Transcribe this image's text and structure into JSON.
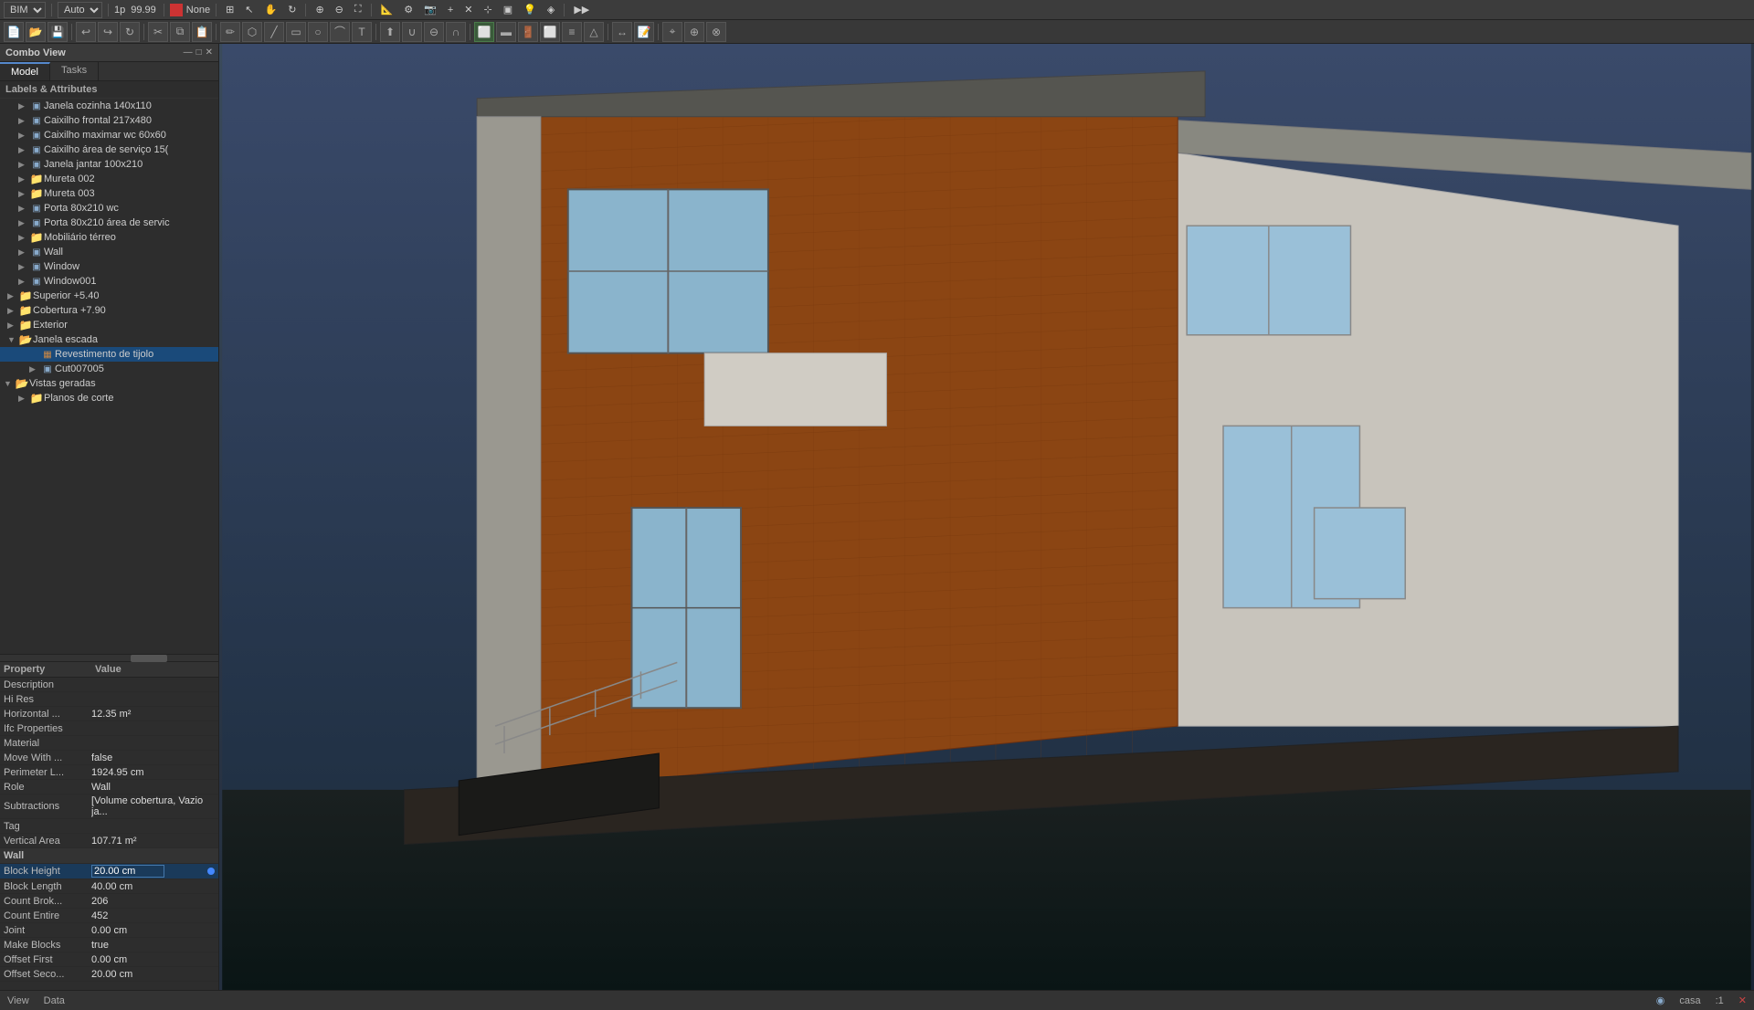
{
  "app": {
    "mode": "BIM",
    "zoom": "99.99",
    "none_label": "None",
    "title": "Combo View"
  },
  "tabs": {
    "model": "Model",
    "tasks": "Tasks"
  },
  "panel": {
    "active_tab": "Model",
    "labels_header": "Labels & Attributes"
  },
  "tree": {
    "items": [
      {
        "id": "t1",
        "label": "Janela cozinha 140x110",
        "indent": 2,
        "type": "obj",
        "expanded": false
      },
      {
        "id": "t2",
        "label": "Caixilho frontal 217x480",
        "indent": 2,
        "type": "obj",
        "expanded": false
      },
      {
        "id": "t3",
        "label": "Caixilho maximar wc 60x60",
        "indent": 2,
        "type": "obj",
        "expanded": false
      },
      {
        "id": "t4",
        "label": "Caixilho área de serviço 15(",
        "indent": 2,
        "type": "obj",
        "expanded": false
      },
      {
        "id": "t5",
        "label": "Janela jantar 100x210",
        "indent": 2,
        "type": "obj",
        "expanded": false
      },
      {
        "id": "t6",
        "label": "Mureta 002",
        "indent": 2,
        "type": "folder",
        "expanded": false
      },
      {
        "id": "t7",
        "label": "Mureta 003",
        "indent": 2,
        "type": "folder",
        "expanded": false
      },
      {
        "id": "t8",
        "label": "Porta 80x210 wc",
        "indent": 2,
        "type": "obj",
        "expanded": false
      },
      {
        "id": "t9",
        "label": "Porta 80x210 área de servic",
        "indent": 2,
        "type": "obj",
        "expanded": false
      },
      {
        "id": "t10",
        "label": "Mobiliário térreo",
        "indent": 2,
        "type": "folder",
        "expanded": false
      },
      {
        "id": "t11",
        "label": "Wall",
        "indent": 2,
        "type": "obj",
        "expanded": false
      },
      {
        "id": "t12",
        "label": "Window",
        "indent": 2,
        "type": "obj",
        "expanded": false
      },
      {
        "id": "t13",
        "label": "Window001",
        "indent": 2,
        "type": "obj",
        "expanded": false
      },
      {
        "id": "t14",
        "label": "Superior +5.40",
        "indent": 1,
        "type": "folder",
        "expanded": false
      },
      {
        "id": "t15",
        "label": "Cobertura +7.90",
        "indent": 1,
        "type": "folder",
        "expanded": false
      },
      {
        "id": "t16",
        "label": "Exterior",
        "indent": 1,
        "type": "folder",
        "expanded": false
      },
      {
        "id": "t17",
        "label": "Janela escada",
        "indent": 1,
        "type": "folder",
        "expanded": true
      },
      {
        "id": "t18",
        "label": "Revestimento de tijolo",
        "indent": 2,
        "type": "brick",
        "expanded": false,
        "selected": true
      },
      {
        "id": "t19",
        "label": "Cut007005",
        "indent": 2,
        "type": "obj",
        "expanded": false
      },
      {
        "id": "t20",
        "label": "Vistas geradas",
        "indent": 0,
        "type": "folder",
        "expanded": true
      },
      {
        "id": "t21",
        "label": "Planos de corte",
        "indent": 1,
        "type": "folder",
        "expanded": false
      }
    ]
  },
  "properties": {
    "col_property": "Property",
    "col_value": "Value",
    "rows": [
      {
        "name": "Description",
        "value": "",
        "section": false
      },
      {
        "name": "Hi Res",
        "value": "",
        "section": false
      },
      {
        "name": "Horizontal ...",
        "value": "12.35 m^2",
        "section": false
      },
      {
        "name": "Ifc Properties",
        "value": "",
        "section": false
      },
      {
        "name": "Material",
        "value": "",
        "section": false
      },
      {
        "name": "Move With ...",
        "value": "false",
        "section": false
      },
      {
        "name": "Perimeter L...",
        "value": "1924.95 cm",
        "section": false
      },
      {
        "name": "Role",
        "value": "Wall",
        "section": false
      },
      {
        "name": "Subtractions",
        "value": "[Volume cobertura, Vazio ja...",
        "section": false
      },
      {
        "name": "Tag",
        "value": "",
        "section": false
      },
      {
        "name": "Vertical Area",
        "value": "107.71 m^2",
        "section": false
      },
      {
        "name": "Wall",
        "value": "",
        "section": true
      },
      {
        "name": "Block Height",
        "value": "20.00 cm",
        "section": false,
        "highlighted": true,
        "editable": true
      },
      {
        "name": "Block Length",
        "value": "40.00 cm",
        "section": false
      },
      {
        "name": "Count Brok...",
        "value": "206",
        "section": false
      },
      {
        "name": "Count Entire",
        "value": "452",
        "section": false
      },
      {
        "name": "Joint",
        "value": "0.00 cm",
        "section": false
      },
      {
        "name": "Make Blocks",
        "value": "true",
        "section": false
      },
      {
        "name": "Offset First",
        "value": "0.00 cm",
        "section": false
      },
      {
        "name": "Offset Seco...",
        "value": "20.00 cm",
        "section": false
      }
    ]
  },
  "status_bar": {
    "view_label": "View",
    "data_label": "Data",
    "casa_label": "casa",
    "scale": ":1",
    "close_icon": "✕"
  },
  "toolbar": {
    "bim_label": "BIM",
    "auto_label": "Auto",
    "none_label": "None",
    "zoom_val": "99.99"
  }
}
